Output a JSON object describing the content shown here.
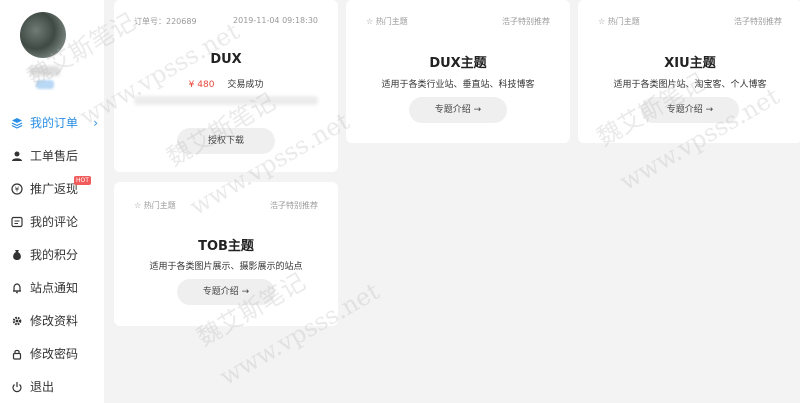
{
  "sidebar": {
    "items": [
      {
        "label": "我的订单",
        "active": true
      },
      {
        "label": "工单售后"
      },
      {
        "label": "推广返现",
        "badge": "HOT"
      },
      {
        "label": "我的评论"
      },
      {
        "label": "我的积分"
      },
      {
        "label": "站点通知"
      },
      {
        "label": "修改资料"
      },
      {
        "label": "修改密码"
      },
      {
        "label": "退出"
      }
    ]
  },
  "order": {
    "number_label": "订单号：220689",
    "datetime": "2019-11-04 09:18:30",
    "title": "DUX",
    "price": "¥ 480",
    "status": "交易成功",
    "button": "授权下载"
  },
  "themes": [
    {
      "tag": "☆ 热门主题",
      "recommend": "浩子特别推荐",
      "title": "DUX主题",
      "desc": "适用于各类行业站、垂直站、科技博客",
      "button": "专题介绍 →"
    },
    {
      "tag": "☆ 热门主题",
      "recommend": "浩子特别推荐",
      "title": "XIU主题",
      "desc": "适用于各类图片站、淘宝客、个人博客",
      "button": "专题介绍 →"
    },
    {
      "tag": "☆ 热门主题",
      "recommend": "浩子特别推荐",
      "title": "TOB主题",
      "desc": "适用于各类图片展示、摄影展示的站点",
      "button": "专题介绍 →"
    }
  ],
  "watermark": {
    "text": "魏艾斯笔记",
    "url": "www.vpsss.net"
  },
  "colors": {
    "accent": "#2a8fe6",
    "price": "#e8473a",
    "hot": "#f25b5b"
  }
}
